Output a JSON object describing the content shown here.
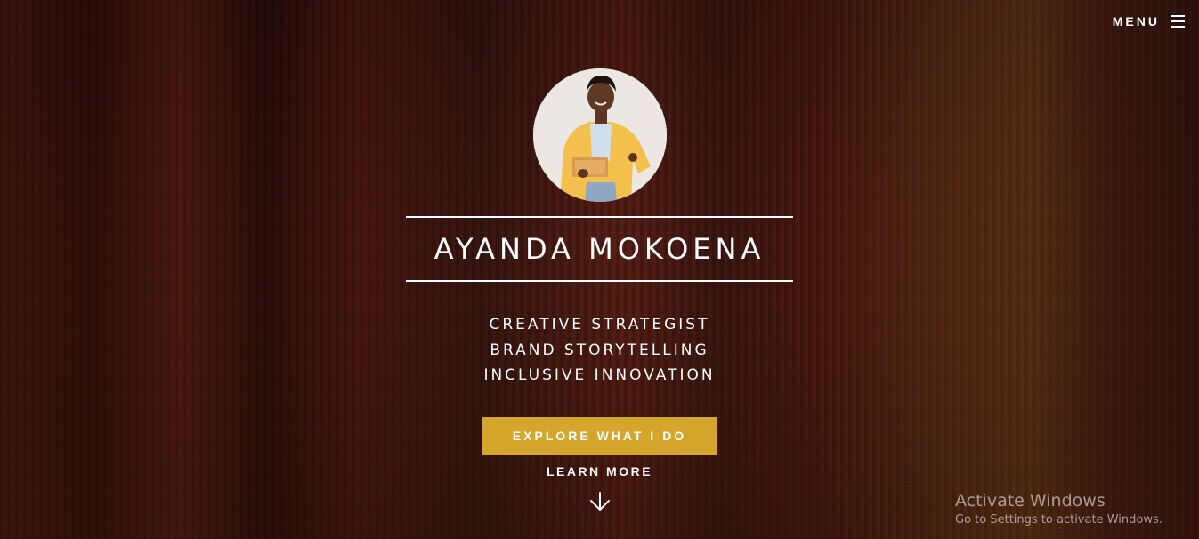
{
  "nav": {
    "menu_label": "MENU",
    "menu_icon": "hamburger-icon"
  },
  "hero": {
    "avatar_icon": "profile-photo",
    "name": "AYANDA MOKOENA",
    "taglines": [
      "CREATIVE STRATEGIST",
      "BRAND STORYTELLING",
      "INCLUSIVE INNOVATION"
    ],
    "cta_label": "EXPLORE WHAT I DO",
    "learn_more_label": "LEARN MORE",
    "scroll_icon": "arrow-down-icon"
  },
  "colors": {
    "accent": "#d4a62b",
    "text": "#ffffff",
    "background": "#3a0f0c"
  },
  "watermark": {
    "title": "Activate Windows",
    "subtitle": "Go to Settings to activate Windows."
  }
}
